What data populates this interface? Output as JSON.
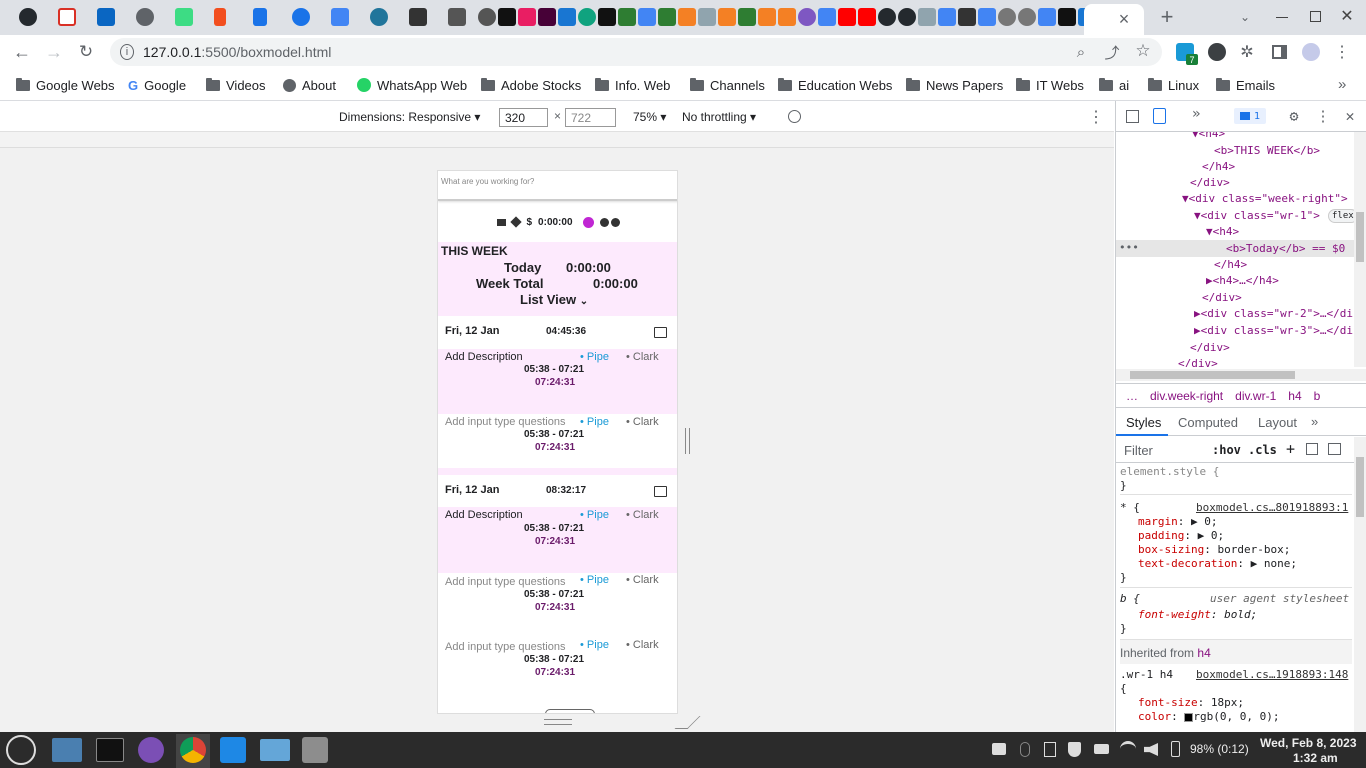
{
  "browser": {
    "tab_close": "×",
    "new_tab": "+",
    "url_host": "127.0.0.1",
    "url_path": ":5500/boxmodel.html",
    "extension_badges": [
      "7"
    ],
    "bookmarks": [
      {
        "label": "Google Webs",
        "icon": "folder-icon"
      },
      {
        "label": "Google",
        "icon": "google-icon"
      },
      {
        "label": "Videos",
        "icon": "folder-icon"
      },
      {
        "label": "About",
        "icon": "globe-icon"
      },
      {
        "label": "WhatsApp Web",
        "icon": "whatsapp-icon"
      },
      {
        "label": "Adobe Stocks",
        "icon": "folder-icon"
      },
      {
        "label": "Info. Web",
        "icon": "folder-icon"
      },
      {
        "label": "Channels",
        "icon": "folder-icon"
      },
      {
        "label": "Education Webs",
        "icon": "folder-icon"
      },
      {
        "label": "News Papers",
        "icon": "folder-icon"
      },
      {
        "label": "IT Webs",
        "icon": "folder-icon"
      },
      {
        "label": "ai",
        "icon": "folder-icon"
      },
      {
        "label": "Linux",
        "icon": "folder-icon"
      },
      {
        "label": "Emails",
        "icon": "folder-icon"
      }
    ],
    "bookmarks_overflow": "»"
  },
  "device_toolbar": {
    "dimensions": "Dimensions: Responsive",
    "width": "320",
    "times": "×",
    "height": "722",
    "zoom": "75%",
    "throttling": "No throttling"
  },
  "app": {
    "placeholder": "What are you working for?",
    "dollar": "$",
    "timer": "0:00:00",
    "week_title": "THIS WEEK",
    "today_label": "Today",
    "today_value": "0:00:00",
    "week_total_label": "Week Total",
    "week_total_value": "0:00:00",
    "list_view": "List View",
    "days": [
      {
        "date": "Fri, 12 Jan",
        "total": "04:45:36",
        "entries": [
          {
            "desc": "Add Description",
            "tag1": "Pipe",
            "tag2": "Clark",
            "range": "05:38 - 07:21",
            "duration": "07:24:31"
          },
          {
            "desc": "Add input type questions",
            "tag1": "Pipe",
            "tag2": "Clark",
            "range": "05:38 - 07:21",
            "duration": "07:24:31"
          }
        ]
      },
      {
        "date": "Fri, 12 Jan",
        "total": "08:32:17",
        "entries": [
          {
            "desc": "Add Description",
            "tag1": "Pipe",
            "tag2": "Clark",
            "range": "05:38 - 07:21",
            "duration": "07:24:31"
          },
          {
            "desc": "Add input type questions",
            "tag1": "Pipe",
            "tag2": "Clark",
            "range": "05:38 - 07:21",
            "duration": "07:24:31"
          },
          {
            "desc": "Add input type questions",
            "tag1": "Pipe",
            "tag2": "Clark",
            "range": "05:38 - 07:21",
            "duration": "07:24:31"
          }
        ]
      }
    ]
  },
  "devtools": {
    "issues_count": "1",
    "dom": [
      {
        "indent": 6,
        "text": "▼<h4>"
      },
      {
        "indent": 8,
        "text": "<b>THIS WEEK</b>"
      },
      {
        "indent": 7,
        "text": "</h4>"
      },
      {
        "indent": 6,
        "text": "</div>"
      },
      {
        "indent": 5,
        "text": "▼<div class=\"week-right\">"
      },
      {
        "indent": 6,
        "text": "▼<div class=\"wr-1\">"
      },
      {
        "indent": 7,
        "text": "▼<h4>"
      },
      {
        "indent": 8,
        "text": "<b>Today</b> == $0"
      },
      {
        "indent": 7,
        "text": "</h4>"
      },
      {
        "indent": 7,
        "text": "▶<h4>…</h4>"
      },
      {
        "indent": 6,
        "text": "</div>"
      },
      {
        "indent": 6,
        "text": "▶<div class=\"wr-2\">…</di"
      },
      {
        "indent": 6,
        "text": "▶<div class=\"wr-3\">…</di"
      },
      {
        "indent": 5,
        "text": "</div>"
      },
      {
        "indent": 4,
        "text": "</div>"
      }
    ],
    "flex_badge": "flex",
    "breadcrumbs": [
      "…",
      "div.week-right",
      "div.wr-1",
      "h4",
      "b"
    ],
    "tabs": [
      "Styles",
      "Computed",
      "Layout",
      "»"
    ],
    "filter_placeholder": "Filter",
    "hov": ":hov",
    "cls": ".cls",
    "rules": [
      {
        "selector": "element.style {",
        "source": "",
        "props": [],
        "close": "}"
      },
      {
        "selector": "* {",
        "source": "boxmodel.cs…801918893:1",
        "props": [
          {
            "name": "margin",
            "value": "▶ 0;"
          },
          {
            "name": "padding",
            "value": "▶ 0;"
          },
          {
            "name": "box-sizing",
            "value": "border-box;"
          },
          {
            "name": "text-decoration",
            "value": "▶ none;"
          }
        ],
        "close": "}"
      },
      {
        "selector": "b {",
        "source": "user agent stylesheet",
        "props": [
          {
            "name": "font-weight",
            "value": "bold;"
          }
        ],
        "close": "}"
      }
    ],
    "inherited_label": "Inherited from",
    "inherited_tag": "h4",
    "rule_wr1": {
      "selector": ".wr-1 h4",
      "source": "boxmodel.cs…1918893:148",
      "open": "{",
      "props": [
        {
          "name": "font-size",
          "value": "18px;"
        },
        {
          "name": "color",
          "value": "rgb(0, 0, 0);"
        }
      ]
    }
  },
  "taskbar": {
    "battery": "98% (0:12)",
    "date": "Wed, Feb 8, 2023",
    "time": "1:32 am"
  },
  "colors": {
    "pink_bg": "#fdeafd",
    "tag_blue": "#1a9ad6",
    "duration": "#6a1b6a",
    "accent": "#1a73e8"
  }
}
